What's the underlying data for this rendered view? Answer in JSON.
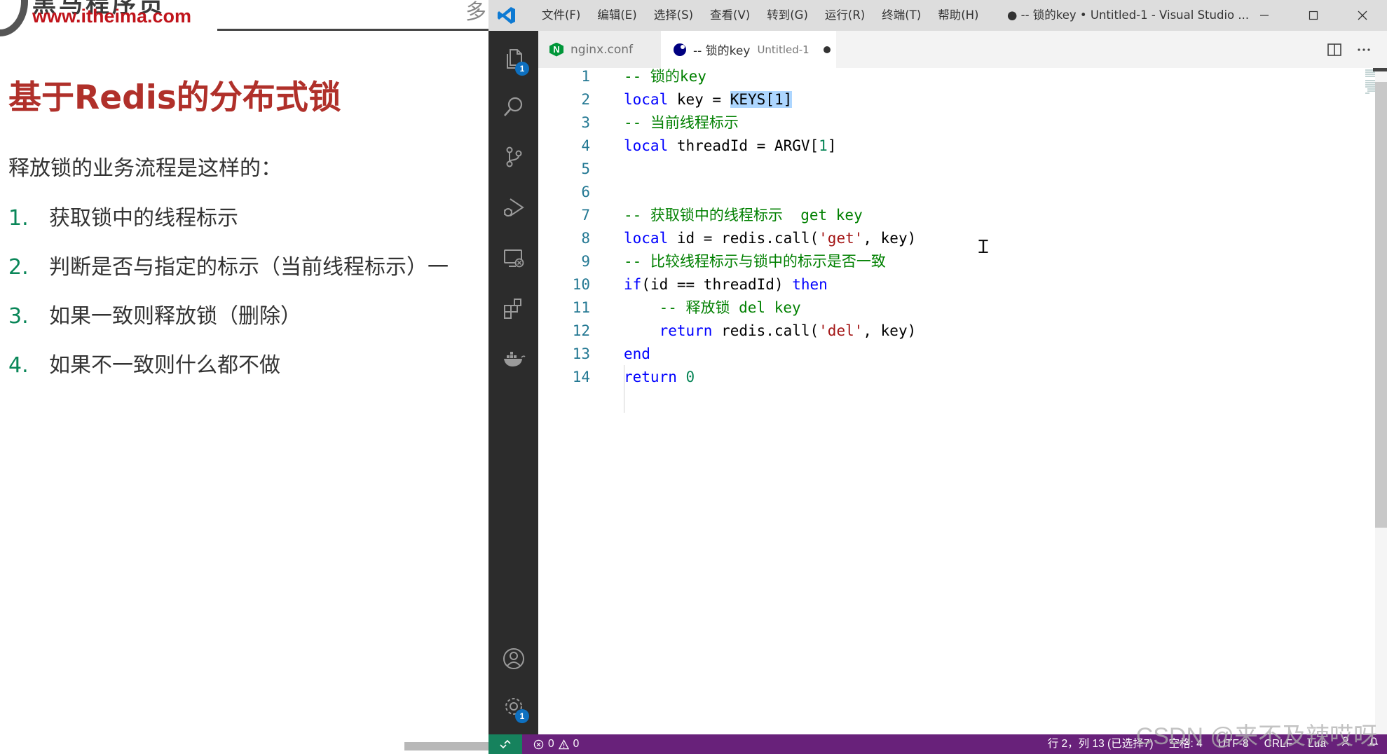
{
  "slide": {
    "logo_cn": "黑马程序员",
    "logo_url": "www.itheima.com",
    "top_fragment": "多",
    "title": "基于Redis的分布式锁",
    "intro": "释放锁的业务流程是这样的：",
    "steps": [
      {
        "num": "1.",
        "text": "获取锁中的线程标示"
      },
      {
        "num": "2.",
        "text": "判断是否与指定的标示（当前线程标示）一"
      },
      {
        "num": "3.",
        "text": "如果一致则释放锁（删除）"
      },
      {
        "num": "4.",
        "text": "如果不一致则什么都不做"
      }
    ]
  },
  "titlebar": {
    "menu": [
      "文件(F)",
      "编辑(E)",
      "选择(S)",
      "查看(V)",
      "转到(G)",
      "运行(R)",
      "终端(T)",
      "帮助(H)"
    ],
    "title": "● -- 锁的key • Untitled-1 - Visual Studio ..."
  },
  "activity_badges": {
    "explorer": "1",
    "settings": "1"
  },
  "tabs": [
    {
      "label": "nginx.conf"
    },
    {
      "label": "-- 锁的key",
      "description": "Untitled-1"
    }
  ],
  "code_lines": [
    {
      "n": "1",
      "parts": [
        [
          "cm",
          "-- 锁的key"
        ]
      ]
    },
    {
      "n": "2",
      "parts": [
        [
          "kw",
          "local"
        ],
        [
          "code",
          " key = "
        ],
        [
          "sel",
          "KEYS[1]"
        ]
      ]
    },
    {
      "n": "3",
      "parts": [
        [
          "cm",
          "-- 当前线程标示"
        ]
      ]
    },
    {
      "n": "4",
      "parts": [
        [
          "kw",
          "local"
        ],
        [
          "code",
          " threadId = ARGV["
        ],
        [
          "num",
          "1"
        ],
        [
          "code",
          "]"
        ]
      ]
    },
    {
      "n": "5",
      "parts": []
    },
    {
      "n": "6",
      "parts": []
    },
    {
      "n": "7",
      "parts": [
        [
          "cm",
          "-- 获取锁中的线程标示  get key"
        ]
      ]
    },
    {
      "n": "8",
      "parts": [
        [
          "kw",
          "local"
        ],
        [
          "code",
          " id = redis.call("
        ],
        [
          "str",
          "'get'"
        ],
        [
          "code",
          ", key)"
        ]
      ]
    },
    {
      "n": "9",
      "parts": [
        [
          "cm",
          "-- 比较线程标示与锁中的标示是否一致"
        ]
      ]
    },
    {
      "n": "10",
      "parts": [
        [
          "kw",
          "if"
        ],
        [
          "code",
          "(id == threadId) "
        ],
        [
          "kw",
          "then"
        ]
      ]
    },
    {
      "n": "11",
      "parts": [
        [
          "code",
          "    "
        ],
        [
          "cm",
          "-- 释放锁 del key"
        ]
      ]
    },
    {
      "n": "12",
      "parts": [
        [
          "code",
          "    "
        ],
        [
          "kw",
          "return"
        ],
        [
          "code",
          " redis.call("
        ],
        [
          "str",
          "'del'"
        ],
        [
          "code",
          ", key)"
        ]
      ]
    },
    {
      "n": "13",
      "parts": [
        [
          "kw",
          "end"
        ]
      ]
    },
    {
      "n": "14",
      "parts": [
        [
          "kw",
          "return"
        ],
        [
          "code",
          " "
        ],
        [
          "num",
          "0"
        ]
      ]
    }
  ],
  "statusbar": {
    "errors": "0",
    "warnings": "0",
    "position": "行 2，列 13 (已选择7)",
    "spaces": "空格: 4",
    "encoding": "UTF-8",
    "eol": "CRLF",
    "language": "Lua"
  },
  "watermark": "CSDN @来不及辣哎呀",
  "colors": {
    "statusbar": "#68217a",
    "activitybar": "#2c2c2c",
    "slide_title": "#b0302a",
    "comment": "#008000",
    "keyword": "#0000ff"
  }
}
